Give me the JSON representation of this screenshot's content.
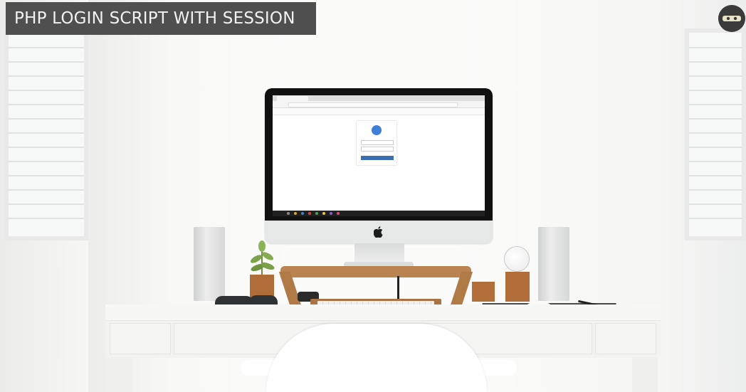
{
  "banner": {
    "title": "PHP LOGIN SCRIPT WITH SESSION"
  },
  "channel_logo": {
    "icon": "ninja-mask-icon"
  },
  "screen": {
    "browser": {
      "icons": [
        "browser-tab",
        "address-bar",
        "bookmark-bar"
      ]
    },
    "login_card": {
      "avatar_icon": "user-avatar-icon"
    }
  },
  "colors": {
    "banner_bg": "#4f4f4f",
    "banner_text": "#f2f2f2",
    "login_button": "#3a6fb3",
    "avatar": "#3f7fd8",
    "wood": "#b36f3a"
  }
}
